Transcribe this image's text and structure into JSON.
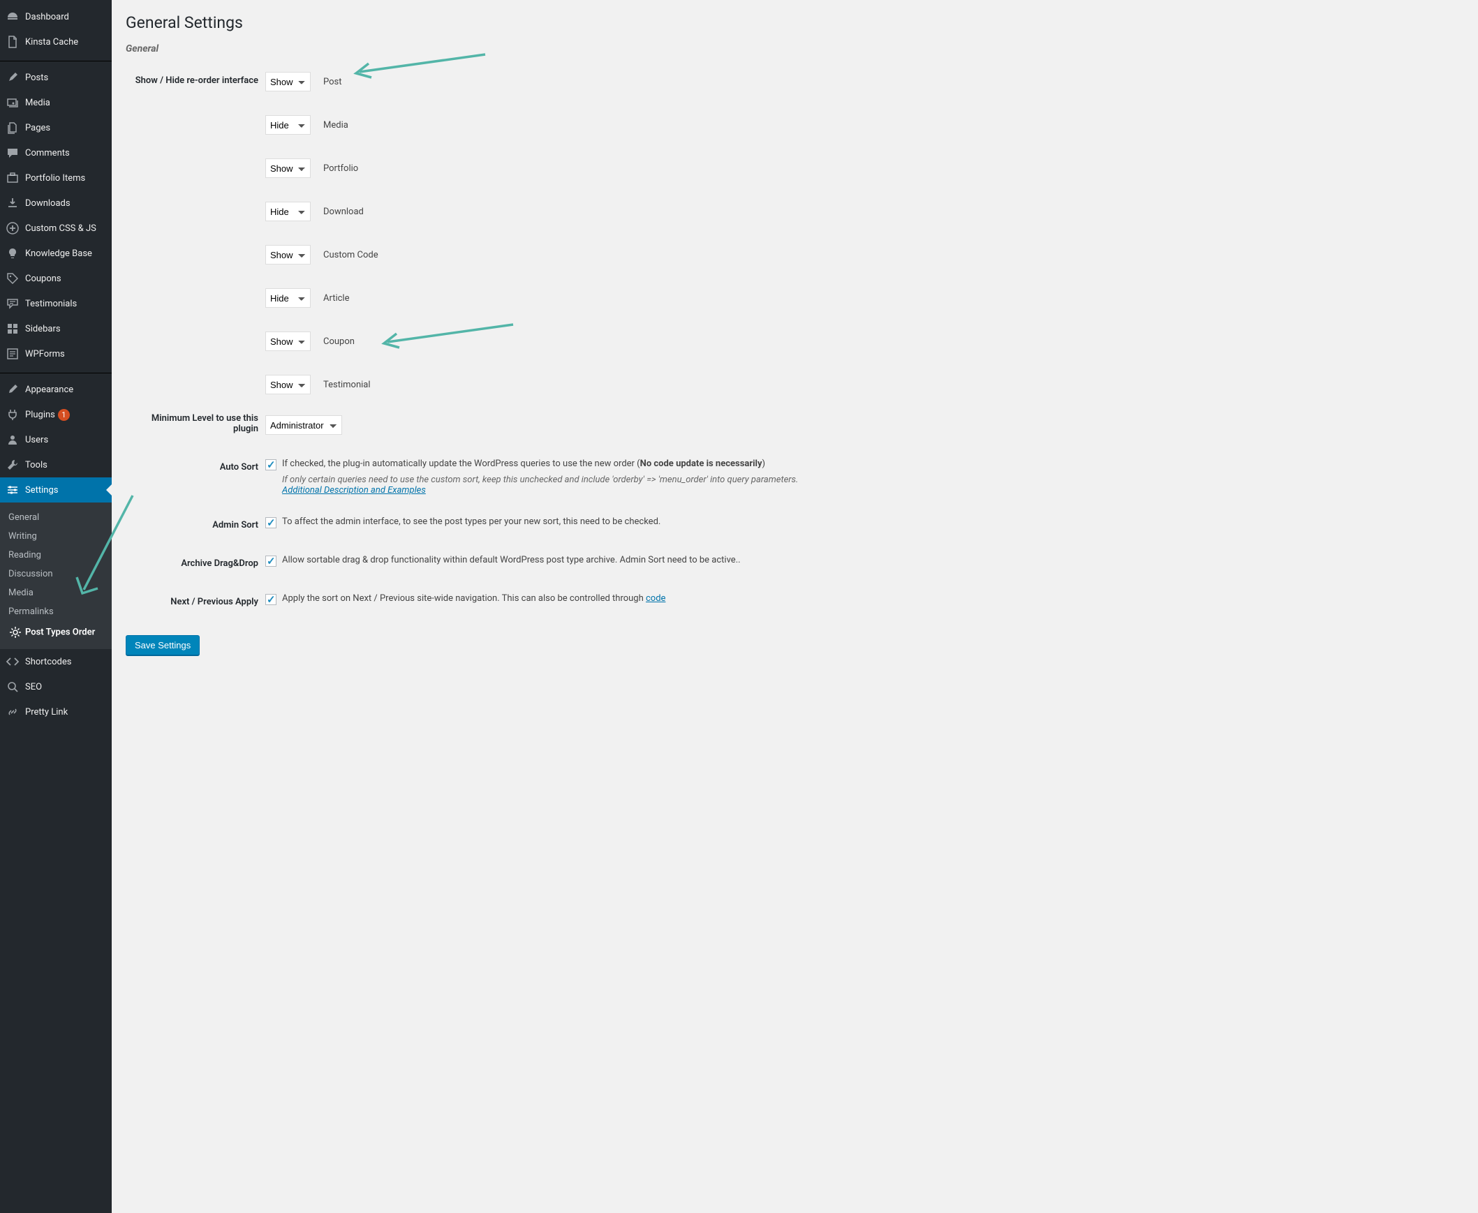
{
  "sidebar": {
    "items": [
      {
        "icon": "dashboard",
        "label": "Dashboard"
      },
      {
        "icon": "page",
        "label": "Kinsta Cache"
      },
      {
        "sep": true
      },
      {
        "icon": "pin",
        "label": "Posts"
      },
      {
        "icon": "media",
        "label": "Media"
      },
      {
        "icon": "pagecopy",
        "label": "Pages"
      },
      {
        "icon": "comment",
        "label": "Comments"
      },
      {
        "icon": "portfolio",
        "label": "Portfolio Items"
      },
      {
        "icon": "download",
        "label": "Downloads"
      },
      {
        "icon": "plus",
        "label": "Custom CSS & JS"
      },
      {
        "icon": "bulb",
        "label": "Knowledge Base"
      },
      {
        "icon": "tag",
        "label": "Coupons"
      },
      {
        "icon": "chat",
        "label": "Testimonials"
      },
      {
        "icon": "grid",
        "label": "Sidebars"
      },
      {
        "icon": "form",
        "label": "WPForms"
      },
      {
        "sep": true
      },
      {
        "icon": "brush",
        "label": "Appearance"
      },
      {
        "icon": "plug",
        "label": "Plugins",
        "badge": "1"
      },
      {
        "icon": "user",
        "label": "Users"
      },
      {
        "icon": "wrench",
        "label": "Tools"
      },
      {
        "icon": "sliders",
        "label": "Settings",
        "active": true
      },
      {
        "icon": "code",
        "label": "Shortcodes"
      },
      {
        "icon": "seo",
        "label": "SEO"
      },
      {
        "icon": "link",
        "label": "Pretty Link"
      }
    ],
    "submenu": [
      {
        "label": "General"
      },
      {
        "label": "Writing"
      },
      {
        "label": "Reading"
      },
      {
        "label": "Discussion"
      },
      {
        "label": "Media"
      },
      {
        "label": "Permalinks"
      },
      {
        "label": "Post Types Order",
        "current": true,
        "icon": "gear"
      }
    ]
  },
  "page": {
    "title": "General Settings",
    "section_general": "General",
    "labels": {
      "show_hide": "Show / Hide re-order interface",
      "min_level": "Minimum Level to use this plugin",
      "auto_sort": "Auto Sort",
      "admin_sort": "Admin Sort",
      "archive_dd": "Archive Drag&Drop",
      "next_prev": "Next / Previous Apply"
    },
    "select_options": {
      "show": "Show",
      "hide": "Hide"
    },
    "post_types": [
      {
        "sel": "Show",
        "label": "Post"
      },
      {
        "sel": "Hide",
        "label": "Media"
      },
      {
        "sel": "Show",
        "label": "Portfolio"
      },
      {
        "sel": "Hide",
        "label": "Download"
      },
      {
        "sel": "Show",
        "label": "Custom Code"
      },
      {
        "sel": "Hide",
        "label": "Article"
      },
      {
        "sel": "Show",
        "label": "Coupon"
      },
      {
        "sel": "Show",
        "label": "Testimonial"
      }
    ],
    "min_level_value": "Administrator",
    "auto_sort": {
      "text_pre": "If checked, the plug-in automatically update the WordPress queries to use the new order (",
      "text_bold": "No code update is necessarily",
      "text_post": ")",
      "desc": "If only certain queries need to use the custom sort, keep this unchecked and include 'orderby' => 'menu_order' into query parameters.",
      "link": "Additional Description and Examples"
    },
    "admin_sort_text": "To affect the admin interface, to see the post types per your new sort, this need to be checked.",
    "archive_text": "Allow sortable drag & drop functionality within default WordPress post type archive. Admin Sort need to be active..",
    "next_prev_pre": "Apply the sort on Next / Previous site-wide navigation. This can also be controlled through ",
    "next_prev_link": "code",
    "save_button": "Save Settings"
  }
}
